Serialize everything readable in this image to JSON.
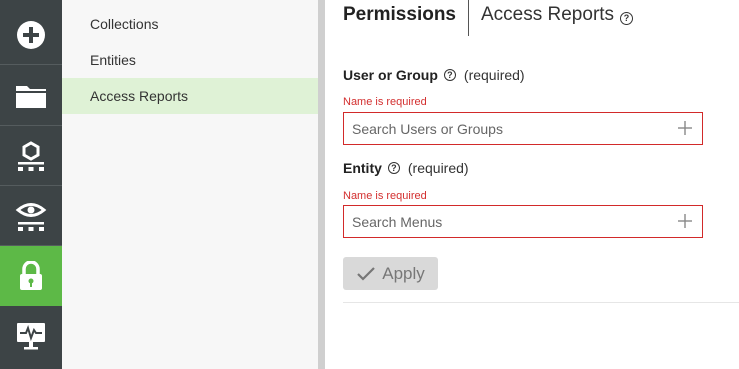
{
  "rail": {
    "items": [
      {
        "icon": "plus-circle-icon"
      },
      {
        "icon": "folder-icon"
      },
      {
        "icon": "hierarchy-icon"
      },
      {
        "icon": "eye-network-icon"
      },
      {
        "icon": "lock-icon",
        "active": true
      },
      {
        "icon": "monitor-pulse-icon"
      }
    ],
    "active_color": "#5db947",
    "background": "#3d4446"
  },
  "subnav": {
    "items": [
      "Collections",
      "Entities",
      "Access Reports"
    ],
    "selected": "Access Reports"
  },
  "tabs": {
    "permissions": "Permissions",
    "access_reports": "Access Reports",
    "help_glyph": "?"
  },
  "form": {
    "user_group": {
      "label": "User or Group",
      "required": "(required)",
      "error": "Name is required",
      "placeholder": "Search Users or Groups"
    },
    "entity": {
      "label": "Entity",
      "required": "(required)",
      "error": "Name is required",
      "placeholder": "Search Menus"
    },
    "apply_label": "Apply",
    "error_color": "#d32f2f"
  }
}
